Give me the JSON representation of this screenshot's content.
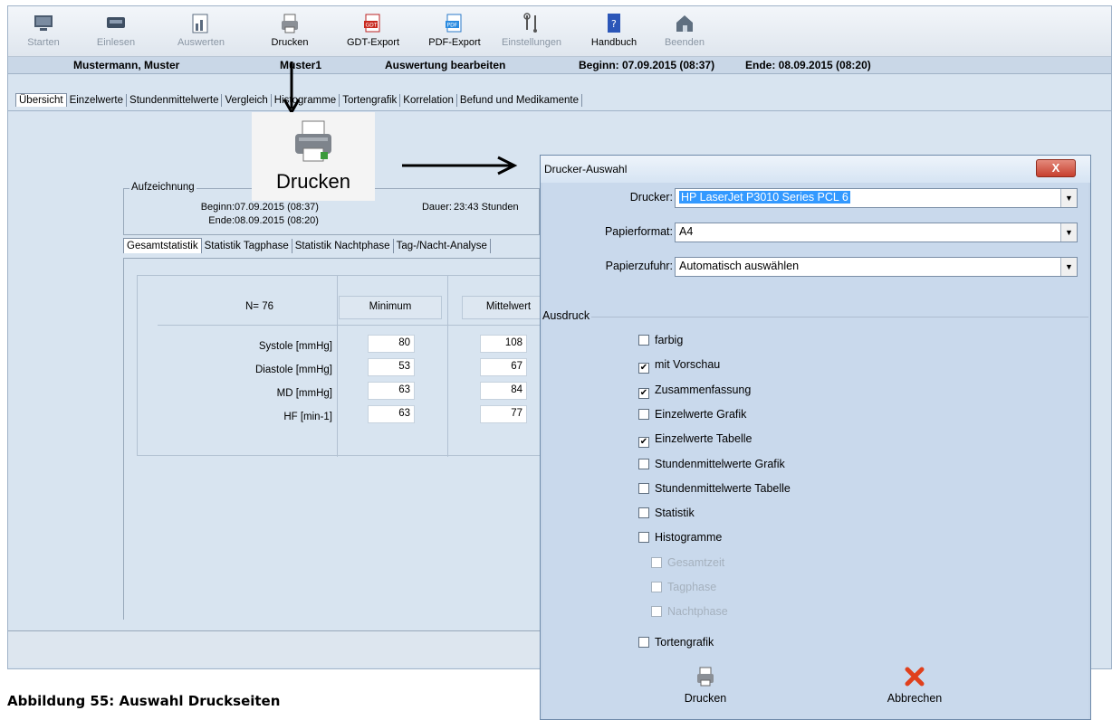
{
  "toolbar": {
    "items": [
      {
        "label": "Starten",
        "icon": "monitor-icon",
        "enabled": false
      },
      {
        "label": "Einlesen",
        "icon": "device-icon",
        "enabled": false
      },
      {
        "label": "Auswerten",
        "icon": "evaluate-icon",
        "enabled": false
      },
      {
        "label": "Drucken",
        "icon": "printer-icon",
        "enabled": true
      },
      {
        "label": "GDT-Export",
        "icon": "gdt-icon",
        "enabled": true
      },
      {
        "label": "PDF-Export",
        "icon": "pdf-icon",
        "enabled": true
      },
      {
        "label": "Einstellungen",
        "icon": "tools-icon",
        "enabled": false
      },
      {
        "label": "Handbuch",
        "icon": "help-book-icon",
        "enabled": true
      },
      {
        "label": "Beenden",
        "icon": "home-exit-icon",
        "enabled": false
      }
    ]
  },
  "statusbar": {
    "patient": "Mustermann, Muster",
    "id": "Muster1",
    "mode": "Auswertung bearbeiten",
    "begin": "Beginn: 07.09.2015  (08:37)",
    "end": "Ende: 08.09.2015  (08:20)"
  },
  "tabs": [
    "Übersicht",
    "Einzelwerte",
    "Stundenmittelwerte",
    "Vergleich",
    "Histogramme",
    "Tortengrafik",
    "Korrelation",
    "Befund und Medikamente"
  ],
  "callout": {
    "label": "Drucken"
  },
  "recording": {
    "legend": "Aufzeichnung",
    "begin_label": "Beginn:",
    "begin_value": "07.09.2015  (08:37)",
    "end_label": "Ende:",
    "end_value": "08.09.2015  (08:20)",
    "duration_label": "Dauer:",
    "duration_value": "23:43 Stunden"
  },
  "subtabs": [
    "Gesamtstatistik",
    "Statistik Tagphase",
    "Statistik Nachtphase",
    "Tag-/Nacht-Analyse"
  ],
  "stats": {
    "n": "N= 76",
    "col_min": "Minimum",
    "col_mean": "Mittelwert",
    "rows": [
      {
        "label": "Systole [mmHg]",
        "min": "80",
        "mean": "108"
      },
      {
        "label": "Diastole [mmHg]",
        "min": "53",
        "mean": "67"
      },
      {
        "label": "MD [mmHg]",
        "min": "63",
        "mean": "84"
      },
      {
        "label": "HF [min-1]",
        "min": "63",
        "mean": "77"
      }
    ]
  },
  "dialog": {
    "title": "Drucker-Auswahl",
    "close": "X",
    "printer_label": "Drucker:",
    "printer_value": "HP LaserJet P3010 Series PCL 6",
    "paper_label": "Papierformat:",
    "paper_value": "A4",
    "feed_label": "Papierzufuhr:",
    "feed_value": "Automatisch auswählen",
    "ausdruck_label": "Ausdruck",
    "options": [
      {
        "label": "farbig",
        "checked": false,
        "enabled": true,
        "indent": false
      },
      {
        "label": "mit Vorschau",
        "checked": true,
        "enabled": true,
        "indent": false
      },
      {
        "label": "Zusammenfassung",
        "checked": true,
        "enabled": true,
        "indent": false
      },
      {
        "label": "Einzelwerte Grafik",
        "checked": false,
        "enabled": true,
        "indent": false
      },
      {
        "label": "Einzelwerte Tabelle",
        "checked": true,
        "enabled": true,
        "indent": false
      },
      {
        "label": "Stundenmittelwerte Grafik",
        "checked": false,
        "enabled": true,
        "indent": false
      },
      {
        "label": "Stundenmittelwerte Tabelle",
        "checked": false,
        "enabled": true,
        "indent": false
      },
      {
        "label": "Statistik",
        "checked": false,
        "enabled": true,
        "indent": false
      },
      {
        "label": "Histogramme",
        "checked": false,
        "enabled": true,
        "indent": false
      },
      {
        "label": "Gesamtzeit",
        "checked": false,
        "enabled": false,
        "indent": true
      },
      {
        "label": "Tagphase",
        "checked": false,
        "enabled": false,
        "indent": true
      },
      {
        "label": "Nachtphase",
        "checked": false,
        "enabled": false,
        "indent": true
      },
      {
        "label": "Tortengrafik",
        "checked": false,
        "enabled": true,
        "indent": false
      }
    ],
    "print_button": "Drucken",
    "cancel_button": "Abbrechen"
  },
  "caption": "Abbildung 55: Auswahl Druckseiten"
}
